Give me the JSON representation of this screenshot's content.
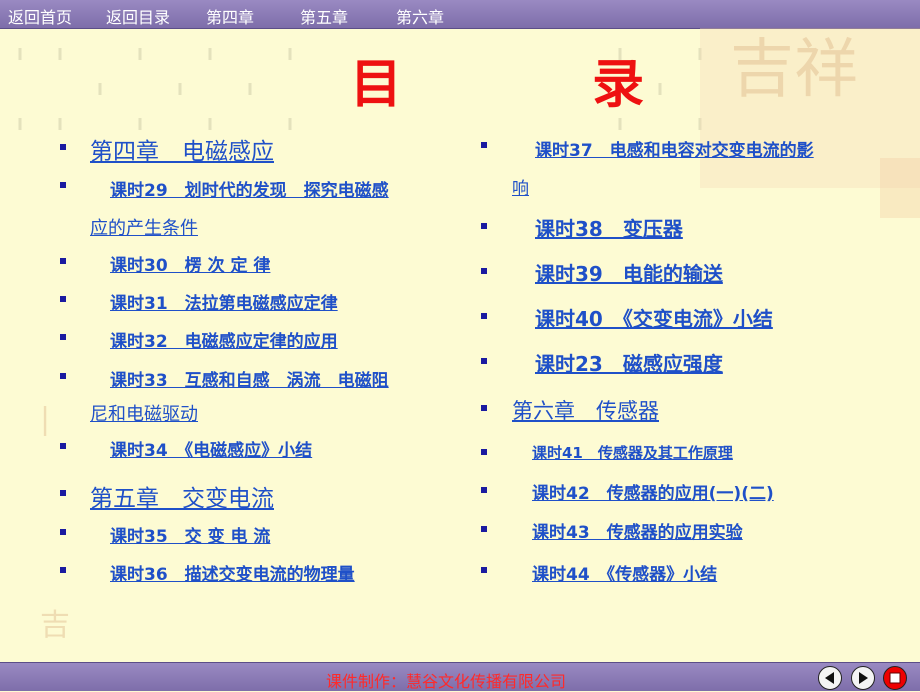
{
  "nav": {
    "home": "返回首页",
    "toc": "返回目录",
    "ch4": "第四章",
    "ch5": "第五章",
    "ch6": "第六章"
  },
  "title": "目 录",
  "left": {
    "ch4_title": "第四章　电磁感应",
    "l29a": "课时29　划时代的发现　探究电磁感",
    "l29b": "应的产生条件",
    "l30": "课时30　楞 次 定 律",
    "l31": "课时31　法拉第电磁感应定律",
    "l32": "课时32　电磁感应定律的应用",
    "l33a": "课时33　互感和自感　涡流　电磁阻",
    "l33b": "尼和电磁驱动",
    "l34": "课时34　《电磁感应》小结",
    "ch5_title": "第五章　交变电流",
    "l35": "课时35　交 变 电 流",
    "l36": "课时36　描述交变电流的物理量"
  },
  "right": {
    "l37a": "课时37　电感和电容对交变电流的影",
    "l37b": "响",
    "l38": "课时38　变压器",
    "l39": "课时39　电能的输送",
    "l40": "课时40　《交变电流》小结",
    "l23": "课时23　磁感应强度",
    "ch6_title": "第六章　传感器",
    "l41": "课时41　传感器及其工作原理",
    "l42": "课时42　传感器的应用(一)(二)",
    "l43": "课时43　传感器的应用实验",
    "l44": "课时44　《传感器》小结"
  },
  "footer": {
    "credit": "课件制作：慧谷文化传播有限公司"
  },
  "colors": {
    "background": "#fdfbd3",
    "title": "#ee1111",
    "link": "#1f50c8",
    "bullet": "#1a1aa0",
    "bar": "#8a7ab6",
    "footer_text": "#ff2a2a"
  },
  "icons": [
    "prev-arrow-icon",
    "next-arrow-icon",
    "stop-icon"
  ]
}
